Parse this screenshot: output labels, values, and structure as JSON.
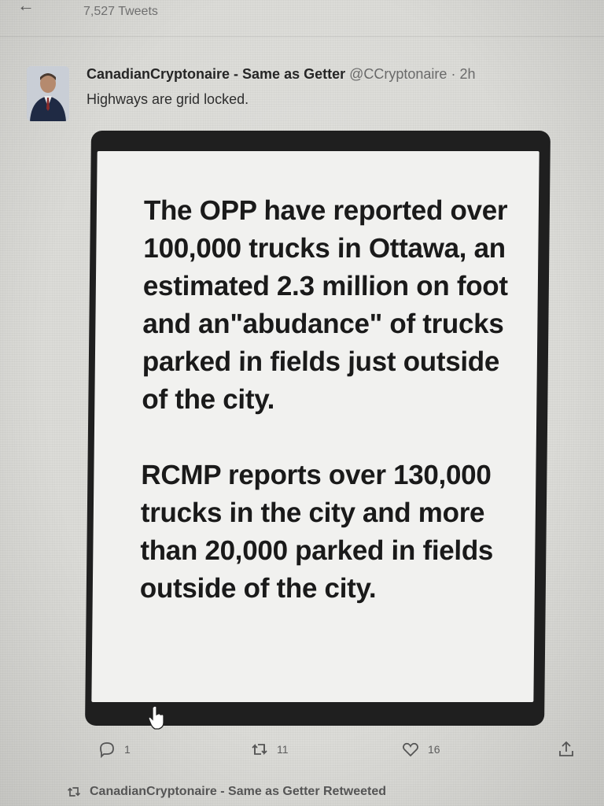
{
  "profile": {
    "tweet_count": "7,527 Tweets"
  },
  "tweet": {
    "author_name": "CanadianCryptonaire - Same as Getter",
    "handle": "@CCryptonaire",
    "separator": "·",
    "time": "2h",
    "text": "Highways are grid locked.",
    "media_paragraphs": [
      "The OPP have reported over 100,000 trucks in Ottawa, an estimated 2.3 million on foot and an\"abudance\" of trucks parked in fields just outside of the city.",
      "RCMP reports over 130,000 trucks in the city and more than 20,000 parked in fields outside of the city."
    ],
    "actions": {
      "reply_icon": "reply-icon",
      "reply_count": "1",
      "retweet_icon": "retweet-icon",
      "retweet_count": "11",
      "like_icon": "heart-icon",
      "like_count": "16",
      "share_icon": "share-icon"
    }
  },
  "retweet_notice": {
    "icon": "retweet-icon",
    "text": "CanadianCryptonaire - Same as Getter Retweeted"
  }
}
